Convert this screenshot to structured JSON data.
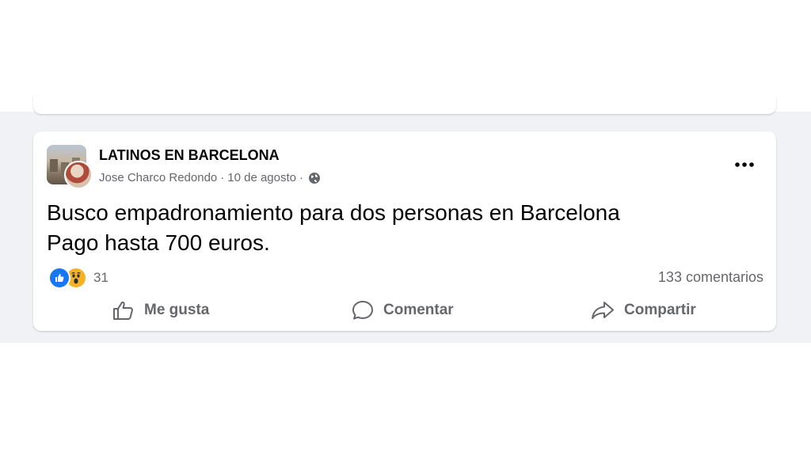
{
  "post": {
    "group_name": "LATINOS EN BARCELONA",
    "author": "Jose Charco Redondo",
    "separator": "·",
    "date": "10 de agosto",
    "privacy_icon": "globe-icon",
    "more_icon": "more-options-icon",
    "text_line1": "Busco empadronamiento para dos personas en Barcelona",
    "text_line2": "Pago hasta 700 euros.",
    "reactions": {
      "types": [
        "like",
        "wow"
      ],
      "count": "31"
    },
    "comments_count": "133 comentarios"
  },
  "actions": {
    "like_label": "Me gusta",
    "comment_label": "Comentar",
    "share_label": "Compartir"
  },
  "colors": {
    "feed_background": "#f0f2f5",
    "card_background": "#ffffff",
    "primary_text": "#050505",
    "secondary_text": "#65676b",
    "like_blue": "#1877f2",
    "wow_yellow": "#f7b125"
  }
}
